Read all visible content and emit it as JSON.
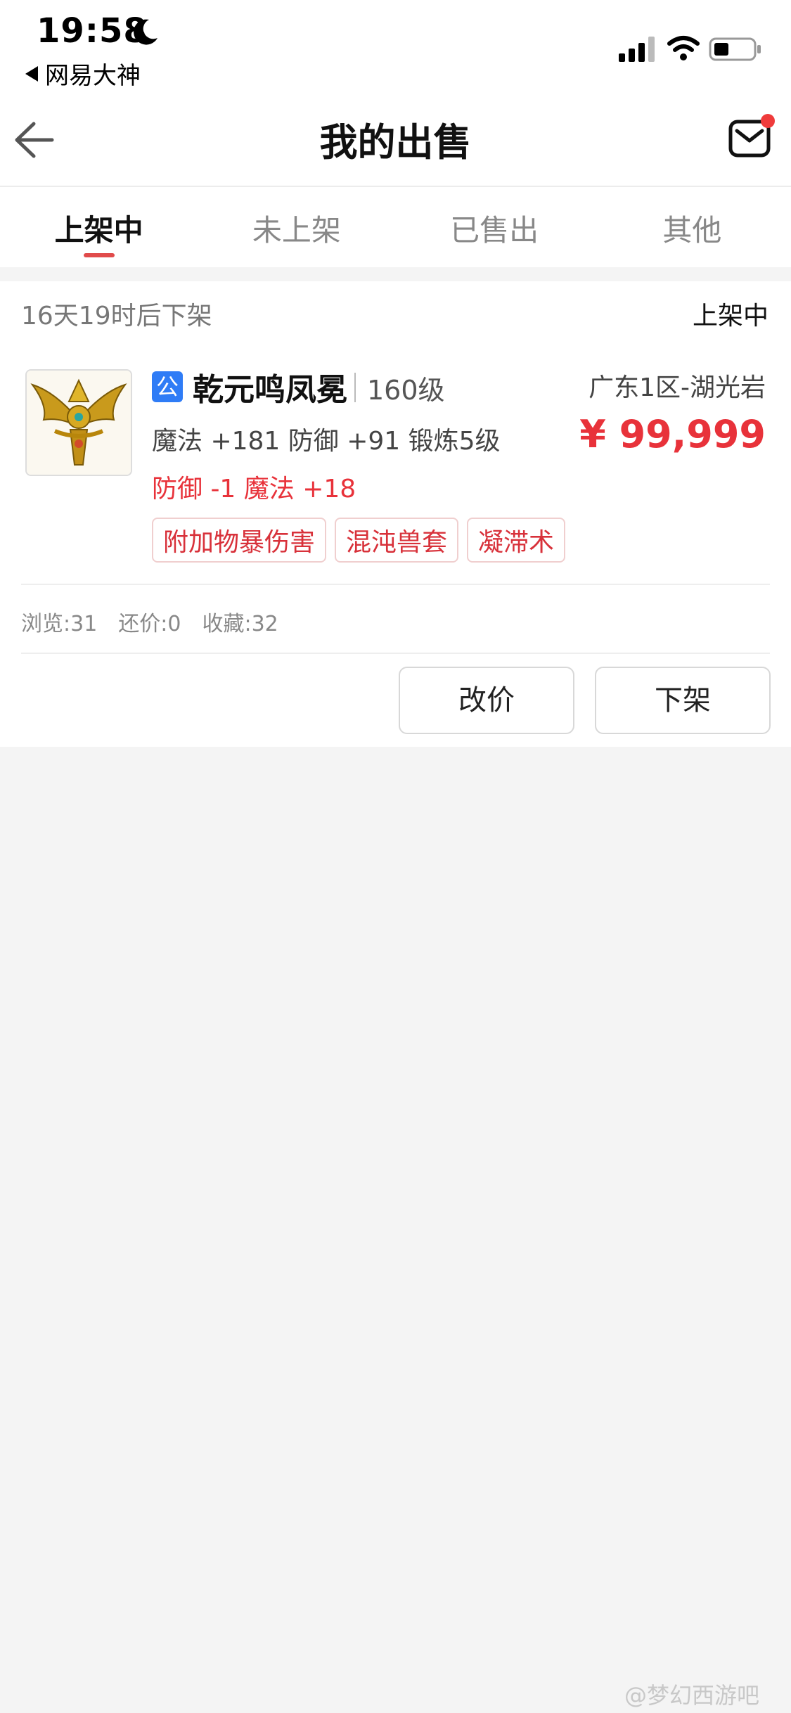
{
  "status_bar": {
    "time": "19:58",
    "back_app": "网易大神"
  },
  "nav": {
    "title": "我的出售"
  },
  "tabs": [
    {
      "label": "上架中",
      "active": true
    },
    {
      "label": "未上架",
      "active": false
    },
    {
      "label": "已售出",
      "active": false
    },
    {
      "label": "其他",
      "active": false
    }
  ],
  "listing": {
    "countdown": "16天19时后下架",
    "status": "上架中",
    "badge": "公",
    "name": "乾元鸣凤冕",
    "level": "160级",
    "server": "广东1区-湖光岩",
    "price": "¥ 99,999",
    "stats_line1": "魔法 +181 防御 +91 锻炼5级",
    "stats_line2": "防御 -1 魔法 +18",
    "tags": [
      "附加物暴伤害",
      "混沌兽套",
      "凝滞术"
    ],
    "counts": {
      "views": "浏览:31",
      "bargains": "还价:0",
      "favorites": "收藏:32"
    },
    "buttons": {
      "change_price": "改价",
      "take_down": "下架"
    }
  },
  "watermark": "@梦幻西游吧",
  "colors": {
    "accent_red": "#e8323a",
    "badge_blue": "#2f7cf6",
    "tab_indicator": "#e14b4b"
  }
}
